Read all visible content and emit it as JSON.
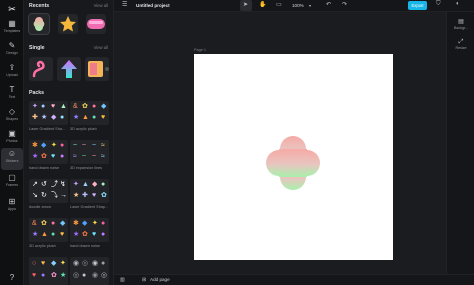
{
  "left_rail": {
    "items": [
      {
        "label": "Templates",
        "icon": "templates-icon",
        "glyph": "▦"
      },
      {
        "label": "Design",
        "icon": "design-icon",
        "glyph": "✎"
      },
      {
        "label": "Upload",
        "icon": "upload-icon",
        "glyph": "⇪"
      },
      {
        "label": "Text",
        "icon": "text-icon",
        "glyph": "T"
      },
      {
        "label": "Shapes",
        "icon": "shapes-icon",
        "glyph": "◇"
      },
      {
        "label": "Photos",
        "icon": "photos-icon",
        "glyph": "▣"
      },
      {
        "label": "Stickers",
        "icon": "stickers-icon",
        "glyph": "☺"
      },
      {
        "label": "Frames",
        "icon": "frames-icon",
        "glyph": "▢"
      },
      {
        "label": "Apps",
        "icon": "apps-icon",
        "glyph": "⊞"
      }
    ],
    "active_index": 6
  },
  "panel": {
    "recents_title": "Recents",
    "single_title": "Single",
    "packs_title": "Packs",
    "view_all": "View all",
    "packs": [
      {
        "label": "Laser Gradient Sha..."
      },
      {
        "label": "3D acrylic plush"
      },
      {
        "label": "hand drawn noise"
      },
      {
        "label": "3D expansion lines"
      },
      {
        "label": "doodle arrow"
      },
      {
        "label": "Laser Gradient Shap..."
      },
      {
        "label": "3D acrylic plush"
      },
      {
        "label": "hand drawn noise"
      }
    ]
  },
  "topbar": {
    "title": "Untitled project",
    "zoom": "100%",
    "export_label": "Export"
  },
  "canvas": {
    "page_label": "Page 1",
    "sticker": "gradient-flower-sticker"
  },
  "right_rail": {
    "items": [
      {
        "label": "Backgr...",
        "icon": "background-icon",
        "glyph": "▤"
      },
      {
        "label": "Resize",
        "icon": "resize-icon",
        "glyph": "⤢"
      }
    ]
  },
  "bottombar": {
    "add_page": "Add page"
  },
  "colors": {
    "accent": "#18b6e8",
    "page": "#ffffff",
    "app_bg": "#151619"
  }
}
